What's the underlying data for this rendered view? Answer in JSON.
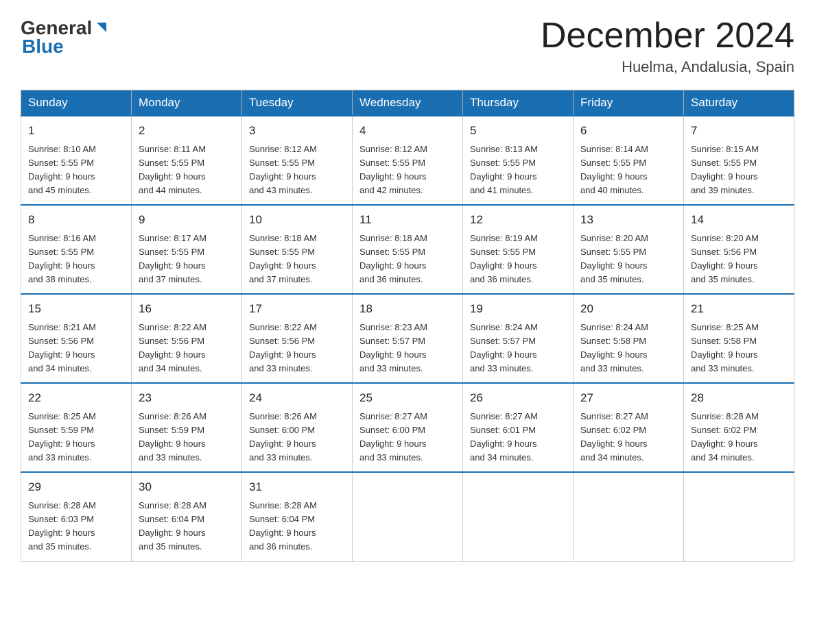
{
  "logo": {
    "general_text": "General",
    "blue_text": "Blue"
  },
  "header": {
    "month": "December 2024",
    "location": "Huelma, Andalusia, Spain"
  },
  "days_of_week": [
    "Sunday",
    "Monday",
    "Tuesday",
    "Wednesday",
    "Thursday",
    "Friday",
    "Saturday"
  ],
  "weeks": [
    [
      {
        "day": "1",
        "sunrise": "8:10 AM",
        "sunset": "5:55 PM",
        "daylight": "9 hours and 45 minutes."
      },
      {
        "day": "2",
        "sunrise": "8:11 AM",
        "sunset": "5:55 PM",
        "daylight": "9 hours and 44 minutes."
      },
      {
        "day": "3",
        "sunrise": "8:12 AM",
        "sunset": "5:55 PM",
        "daylight": "9 hours and 43 minutes."
      },
      {
        "day": "4",
        "sunrise": "8:12 AM",
        "sunset": "5:55 PM",
        "daylight": "9 hours and 42 minutes."
      },
      {
        "day": "5",
        "sunrise": "8:13 AM",
        "sunset": "5:55 PM",
        "daylight": "9 hours and 41 minutes."
      },
      {
        "day": "6",
        "sunrise": "8:14 AM",
        "sunset": "5:55 PM",
        "daylight": "9 hours and 40 minutes."
      },
      {
        "day": "7",
        "sunrise": "8:15 AM",
        "sunset": "5:55 PM",
        "daylight": "9 hours and 39 minutes."
      }
    ],
    [
      {
        "day": "8",
        "sunrise": "8:16 AM",
        "sunset": "5:55 PM",
        "daylight": "9 hours and 38 minutes."
      },
      {
        "day": "9",
        "sunrise": "8:17 AM",
        "sunset": "5:55 PM",
        "daylight": "9 hours and 37 minutes."
      },
      {
        "day": "10",
        "sunrise": "8:18 AM",
        "sunset": "5:55 PM",
        "daylight": "9 hours and 37 minutes."
      },
      {
        "day": "11",
        "sunrise": "8:18 AM",
        "sunset": "5:55 PM",
        "daylight": "9 hours and 36 minutes."
      },
      {
        "day": "12",
        "sunrise": "8:19 AM",
        "sunset": "5:55 PM",
        "daylight": "9 hours and 36 minutes."
      },
      {
        "day": "13",
        "sunrise": "8:20 AM",
        "sunset": "5:55 PM",
        "daylight": "9 hours and 35 minutes."
      },
      {
        "day": "14",
        "sunrise": "8:20 AM",
        "sunset": "5:56 PM",
        "daylight": "9 hours and 35 minutes."
      }
    ],
    [
      {
        "day": "15",
        "sunrise": "8:21 AM",
        "sunset": "5:56 PM",
        "daylight": "9 hours and 34 minutes."
      },
      {
        "day": "16",
        "sunrise": "8:22 AM",
        "sunset": "5:56 PM",
        "daylight": "9 hours and 34 minutes."
      },
      {
        "day": "17",
        "sunrise": "8:22 AM",
        "sunset": "5:56 PM",
        "daylight": "9 hours and 33 minutes."
      },
      {
        "day": "18",
        "sunrise": "8:23 AM",
        "sunset": "5:57 PM",
        "daylight": "9 hours and 33 minutes."
      },
      {
        "day": "19",
        "sunrise": "8:24 AM",
        "sunset": "5:57 PM",
        "daylight": "9 hours and 33 minutes."
      },
      {
        "day": "20",
        "sunrise": "8:24 AM",
        "sunset": "5:58 PM",
        "daylight": "9 hours and 33 minutes."
      },
      {
        "day": "21",
        "sunrise": "8:25 AM",
        "sunset": "5:58 PM",
        "daylight": "9 hours and 33 minutes."
      }
    ],
    [
      {
        "day": "22",
        "sunrise": "8:25 AM",
        "sunset": "5:59 PM",
        "daylight": "9 hours and 33 minutes."
      },
      {
        "day": "23",
        "sunrise": "8:26 AM",
        "sunset": "5:59 PM",
        "daylight": "9 hours and 33 minutes."
      },
      {
        "day": "24",
        "sunrise": "8:26 AM",
        "sunset": "6:00 PM",
        "daylight": "9 hours and 33 minutes."
      },
      {
        "day": "25",
        "sunrise": "8:27 AM",
        "sunset": "6:00 PM",
        "daylight": "9 hours and 33 minutes."
      },
      {
        "day": "26",
        "sunrise": "8:27 AM",
        "sunset": "6:01 PM",
        "daylight": "9 hours and 34 minutes."
      },
      {
        "day": "27",
        "sunrise": "8:27 AM",
        "sunset": "6:02 PM",
        "daylight": "9 hours and 34 minutes."
      },
      {
        "day": "28",
        "sunrise": "8:28 AM",
        "sunset": "6:02 PM",
        "daylight": "9 hours and 34 minutes."
      }
    ],
    [
      {
        "day": "29",
        "sunrise": "8:28 AM",
        "sunset": "6:03 PM",
        "daylight": "9 hours and 35 minutes."
      },
      {
        "day": "30",
        "sunrise": "8:28 AM",
        "sunset": "6:04 PM",
        "daylight": "9 hours and 35 minutes."
      },
      {
        "day": "31",
        "sunrise": "8:28 AM",
        "sunset": "6:04 PM",
        "daylight": "9 hours and 36 minutes."
      },
      null,
      null,
      null,
      null
    ]
  ],
  "labels": {
    "sunrise": "Sunrise:",
    "sunset": "Sunset:",
    "daylight": "Daylight:"
  }
}
